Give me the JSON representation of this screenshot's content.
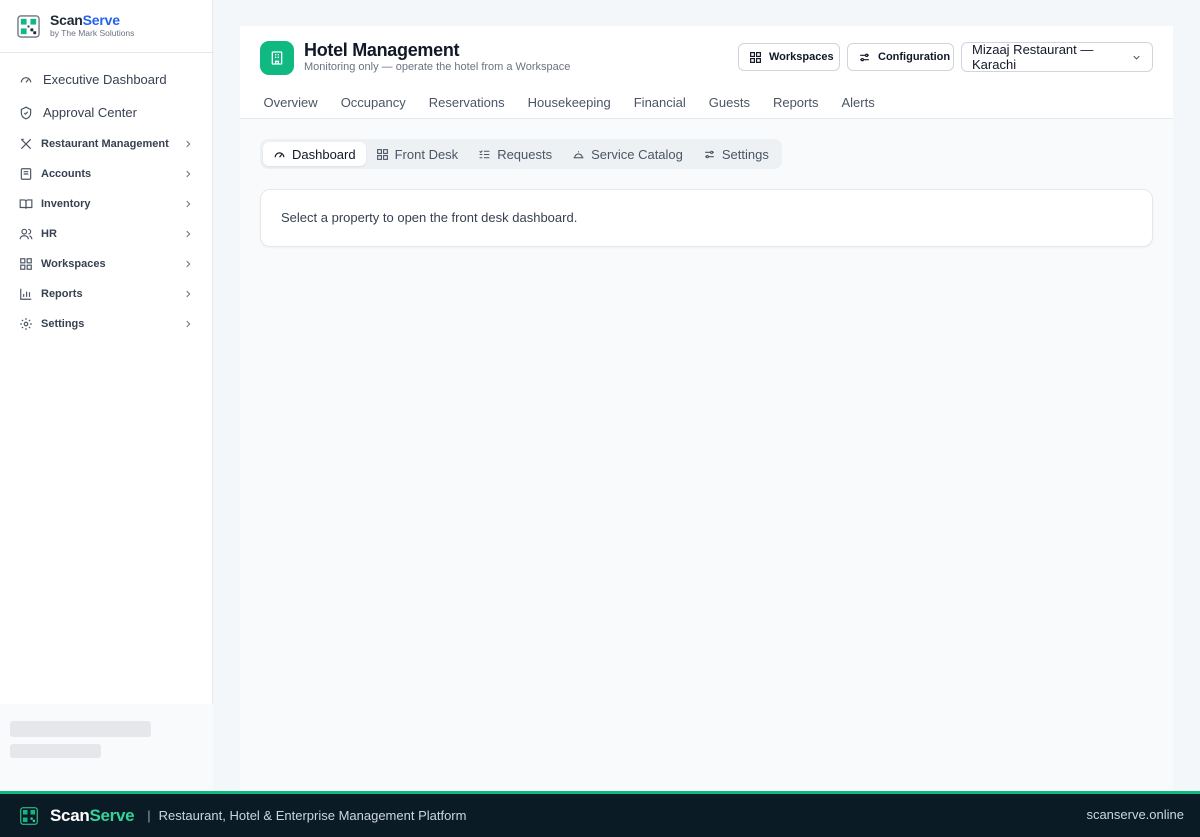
{
  "brand": {
    "name_part1": "Scan",
    "name_part2": "Serve",
    "subtitle": "by The Mark Solutions"
  },
  "sidebar": {
    "items": [
      {
        "label": "Executive Dashboard",
        "icon": "gauge-icon"
      },
      {
        "label": "Approval Center",
        "icon": "shield-check-icon"
      },
      {
        "label": "Restaurant Management",
        "icon": "utensils-icon"
      },
      {
        "label": "Accounts",
        "icon": "receipt-icon"
      },
      {
        "label": "Inventory",
        "icon": "book-open-icon"
      },
      {
        "label": "HR",
        "icon": "users-icon"
      },
      {
        "label": "Workspaces",
        "icon": "grid-icon"
      },
      {
        "label": "Reports",
        "icon": "bar-chart-icon"
      },
      {
        "label": "Settings",
        "icon": "gear-icon"
      }
    ]
  },
  "header": {
    "title": "Hotel Management",
    "subtitle": "Monitoring only — operate the hotel from a Workspace",
    "workspaces_label": "Workspaces",
    "configuration_label": "Configuration",
    "property_select": "Mizaaj Restaurant — Karachi"
  },
  "tabs": [
    "Overview",
    "Occupancy",
    "Reservations",
    "Housekeeping",
    "Financial",
    "Guests",
    "Reports",
    "Alerts"
  ],
  "subtabs": [
    {
      "label": "Dashboard",
      "active": true
    },
    {
      "label": "Front Desk",
      "active": false
    },
    {
      "label": "Requests",
      "active": false
    },
    {
      "label": "Service Catalog",
      "active": false
    },
    {
      "label": "Settings",
      "active": false
    }
  ],
  "card": {
    "message": "Select a property to open the front desk dashboard."
  },
  "footer": {
    "brand_part1": "Scan",
    "brand_part2": "Serve",
    "separator": "|",
    "tagline": "Restaurant, Hotel & Enterprise Management Platform",
    "url": "scanserve.online"
  },
  "colors": {
    "accent": "#10b981",
    "brand_blue": "#2563eb",
    "footer_bg": "#0b1b26"
  }
}
